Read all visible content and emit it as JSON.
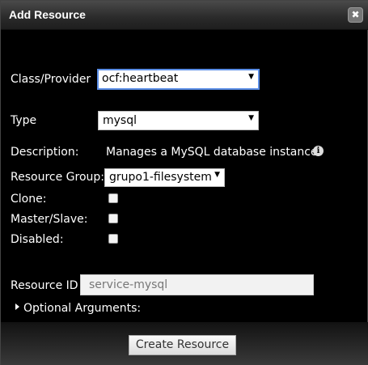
{
  "dialog": {
    "title": "Add Resource",
    "close_glyph": "✖"
  },
  "form": {
    "class_provider_label": "Class/Provider",
    "class_provider_value": "ocf:heartbeat",
    "type_label": "Type",
    "type_value": "mysql",
    "description_label": "Description:",
    "description_text": "Manages a MySQL database instance",
    "info_glyph": "i",
    "resource_group_label": "Resource Group:",
    "resource_group_value": "grupo1-filesystem",
    "clone_label": "Clone:",
    "master_slave_label": "Master/Slave:",
    "disabled_label": "Disabled:",
    "resource_id_label": "Resource ID",
    "resource_id_placeholder": "service-mysql",
    "optional_arguments_label": "Optional Arguments:",
    "dropdown_glyph": "▼"
  },
  "footer": {
    "create_button_label": "Create Resource"
  },
  "icons": {
    "close": "close-icon",
    "info": "info-icon",
    "expand": "triangle-right-icon",
    "dropdown": "chevron-down-icon"
  }
}
